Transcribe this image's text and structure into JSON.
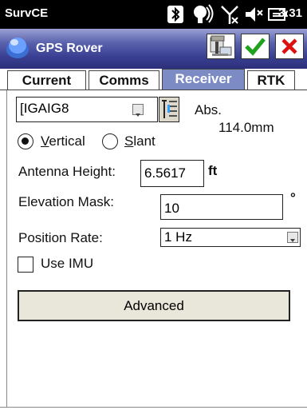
{
  "status_bar": {
    "app_name": "SurvCE",
    "time": "3:31",
    "icons": [
      "bluetooth-icon",
      "gps-signal-icon",
      "no-signal-icon",
      "volume-icon",
      "battery-icon"
    ]
  },
  "title_bar": {
    "title": "GPS Rover",
    "buttons": [
      "receiver-config-icon",
      "check-icon",
      "close-icon"
    ],
    "colors": {
      "check": "#1fa31f",
      "close": "#dd1010",
      "bar": "#3a3f92"
    }
  },
  "tabs": [
    {
      "label": "Current",
      "active": false
    },
    {
      "label": "Comms",
      "active": false
    },
    {
      "label": "Receiver",
      "active": true
    },
    {
      "label": "RTK",
      "active": false
    }
  ],
  "antenna": {
    "selected": "[IGAIG8",
    "abs_label": "Abs.",
    "abs_value": "114.0mm"
  },
  "measure_type": {
    "options": [
      {
        "label": "Vertical",
        "selected": true,
        "underline_char": "V"
      },
      {
        "label": "Slant",
        "selected": false,
        "underline_char": "S"
      }
    ]
  },
  "antenna_height": {
    "label": "Antenna Height:",
    "value": "6.5617",
    "unit": "ft"
  },
  "elevation_mask": {
    "label": "Elevation Mask:",
    "value": "10",
    "unit": "°"
  },
  "position_rate": {
    "label": "Position Rate:",
    "value": "1 Hz"
  },
  "use_imu": {
    "label": "Use IMU",
    "checked": false
  },
  "advanced_button": "Advanced"
}
